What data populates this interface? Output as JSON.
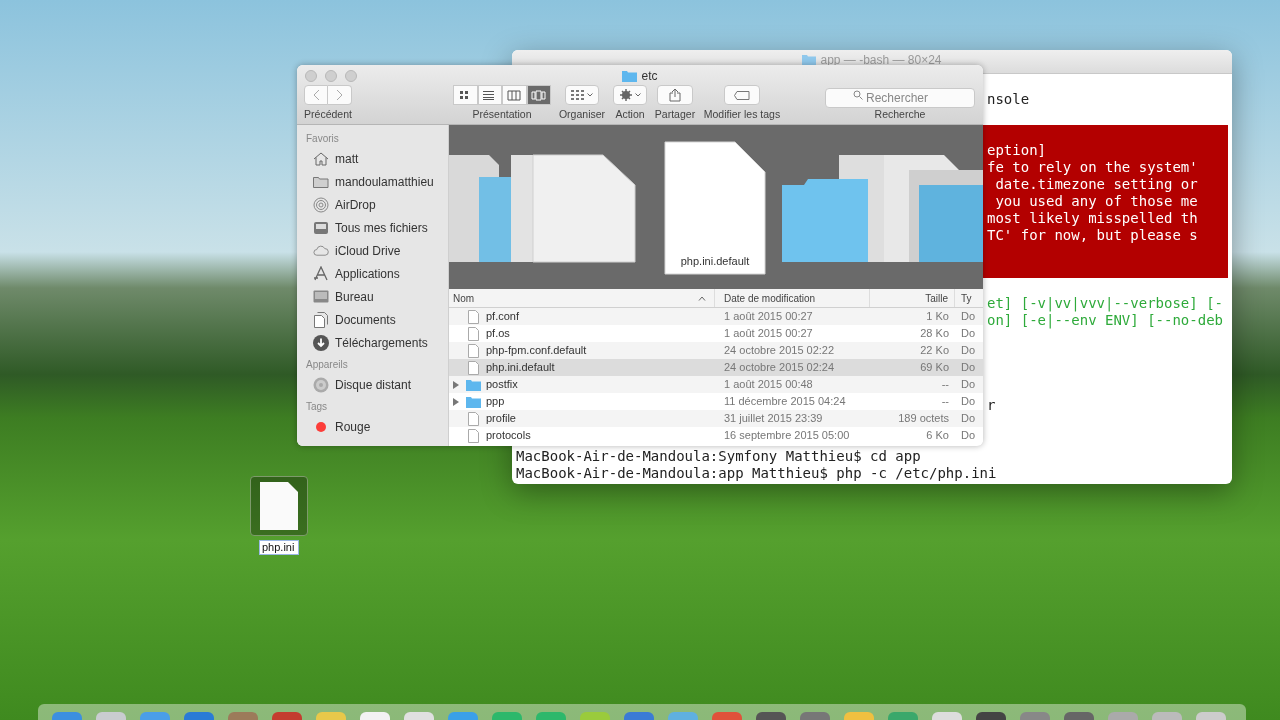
{
  "terminal": {
    "title": "app — -bash — 80×24",
    "lines": [
      {
        "kind": "plain",
        "text": "nsole"
      },
      {
        "kind": "error",
        "text": "eption]"
      },
      {
        "kind": "error",
        "text": "fe to rely on the system'"
      },
      {
        "kind": "error",
        "text": " date.timezone setting or"
      },
      {
        "kind": "error",
        "text": " you used any of those me"
      },
      {
        "kind": "error",
        "text": "most likely misspelled th"
      },
      {
        "kind": "error",
        "text": "TC' for now, but please s"
      },
      {
        "kind": "usage",
        "text": "et] [-v|vv|vvv|--verbose] [-"
      },
      {
        "kind": "usage",
        "text": "on] [-e|--env ENV] [--no-deb"
      },
      {
        "kind": "plain",
        "text": "r"
      },
      {
        "kind": "prompt",
        "text": "MacBook-Air-de-Mandoula:Symfony Matthieu$ cd app"
      },
      {
        "kind": "prompt",
        "text": "MacBook-Air-de-Mandoula:app Matthieu$ php -c /etc/php.ini"
      }
    ]
  },
  "finder": {
    "title": "etc",
    "toolbar": [
      {
        "kind": "nav",
        "label": "Précédent"
      },
      {
        "kind": "views",
        "label": "Présentation"
      },
      {
        "kind": "arrange",
        "label": "Organiser"
      },
      {
        "kind": "action",
        "label": "Action"
      },
      {
        "kind": "share",
        "label": "Partager"
      },
      {
        "kind": "tags",
        "label": "Modifier les tags"
      },
      {
        "kind": "search",
        "label": "Recherche",
        "placeholder": "Rechercher"
      }
    ],
    "sidebar": [
      {
        "title": "Favoris",
        "items": [
          {
            "label": "matt",
            "selected": false
          },
          {
            "label": "mandoulamatthieu",
            "selected": false
          },
          {
            "label": "AirDrop",
            "selected": false
          },
          {
            "label": "Tous mes fichiers",
            "selected": false
          },
          {
            "label": "iCloud Drive",
            "selected": false
          },
          {
            "label": "Applications",
            "selected": false
          },
          {
            "label": "Bureau",
            "selected": false
          },
          {
            "label": "Documents",
            "selected": false
          },
          {
            "label": "Téléchargements",
            "selected": false
          }
        ]
      },
      {
        "title": "Appareils",
        "items": [
          {
            "label": "Disque distant",
            "selected": false
          }
        ]
      },
      {
        "title": "Tags",
        "items": [
          {
            "label": "Rouge",
            "selected": false,
            "color": "#fc3d39"
          }
        ]
      }
    ],
    "preview": {
      "label": "php.ini.default"
    },
    "list": {
      "columns": [
        "Nom",
        "Date de modification",
        "Taille",
        "Ty"
      ],
      "rows": [
        {
          "kind": "file",
          "name": "pf.conf",
          "date": "1 août 2015 00:27",
          "size": "1 Ko",
          "column_4": "Do",
          "selected": false
        },
        {
          "kind": "file",
          "name": "pf.os",
          "date": "1 août 2015 00:27",
          "size": "28 Ko",
          "column_4": "Do",
          "selected": false
        },
        {
          "kind": "file",
          "name": "php-fpm.conf.default",
          "date": "24 octobre 2015 02:22",
          "size": "22 Ko",
          "column_4": "Do",
          "selected": false
        },
        {
          "kind": "file",
          "name": "php.ini.default",
          "date": "24 octobre 2015 02:24",
          "size": "69 Ko",
          "column_4": "Do",
          "selected": true
        },
        {
          "kind": "folder",
          "name": "postfix",
          "date": "1 août 2015 00:48",
          "size": "--",
          "column_4": "Do",
          "selected": false
        },
        {
          "kind": "folder",
          "name": "ppp",
          "date": "11 décembre 2015 04:24",
          "size": "--",
          "column_4": "Do",
          "selected": false
        },
        {
          "kind": "file",
          "name": "profile",
          "date": "31 juillet 2015 23:39",
          "size": "189 octets",
          "column_4": "Do",
          "selected": false
        },
        {
          "kind": "file",
          "name": "protocols",
          "date": "16 septembre 2015 05:00",
          "size": "6 Ko",
          "column_4": "Do",
          "selected": false
        }
      ]
    }
  },
  "desktop_file": {
    "name": "php.ini",
    "selected": true
  }
}
